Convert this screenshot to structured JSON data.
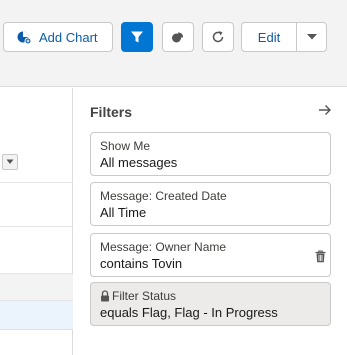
{
  "toolbar": {
    "add_chart_label": "Add Chart",
    "edit_label": "Edit",
    "filter_icon": "filter-icon",
    "chart_icon": "chart-icon",
    "refresh_icon": "refresh-icon",
    "dropdown_icon": "chevron-down-icon",
    "accent_color": "#0176d3"
  },
  "filters": {
    "title": "Filters",
    "collapse_icon": "arrow-right-icon",
    "items": [
      {
        "label": "Show Me",
        "value": "All messages"
      },
      {
        "label": "Message: Created Date",
        "value": "All Time"
      },
      {
        "label": "Message: Owner Name",
        "value": "contains Tovin",
        "removable": true
      },
      {
        "label": "Filter Status",
        "value": "equals Flag, Flag - In Progress",
        "locked": true
      }
    ]
  }
}
